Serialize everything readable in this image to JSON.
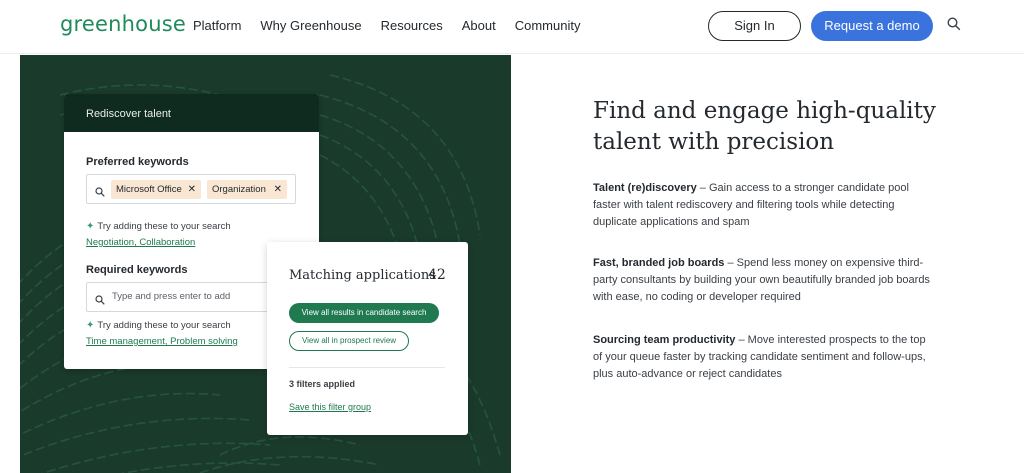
{
  "header": {
    "logo": "greenhouse",
    "nav": [
      "Platform",
      "Why Greenhouse",
      "Resources",
      "About",
      "Community"
    ],
    "sign_in": "Sign In",
    "demo": "Request a demo"
  },
  "card1": {
    "title": "Rediscover talent",
    "preferred_label": "Preferred keywords",
    "chips": [
      "Microsoft Office",
      "Organization"
    ],
    "hint": "Try adding these to your search",
    "preferred_suggestions": [
      "Negotiation",
      "Collaboration"
    ],
    "required_label": "Required keywords",
    "required_placeholder": "Type and press enter to add",
    "required_suggestions": [
      "Time management",
      "Problem solving"
    ]
  },
  "card2": {
    "title": "Matching applications",
    "count": "42",
    "btn_primary": "View all results in candidate search",
    "btn_secondary": "View all in prospect review",
    "filters": "3 filters applied",
    "save": "Save this filter group"
  },
  "right": {
    "title": "Find and engage high-quality talent with precision",
    "features": [
      {
        "name": "Talent (re)discovery",
        "text": " – Gain access to a stronger candidate pool faster with talent rediscovery and filtering tools while detecting duplicate applications and spam"
      },
      {
        "name": "Fast, branded job boards",
        "text": " – Spend less money on expensive third-party consultants by building your own beautifully branded job boards with ease, no coding or developer required"
      },
      {
        "name": "Sourcing team productivity",
        "text": " – Move interested prospects to the top of your queue faster by tracking candidate sentiment and follow-ups, plus auto-advance or reject candidates"
      }
    ]
  },
  "colors": {
    "brand_green": "#1f8a5b",
    "dark_panel": "#1a3a2c",
    "demo_blue": "#3b73de",
    "chip": "#f9e7d3"
  }
}
